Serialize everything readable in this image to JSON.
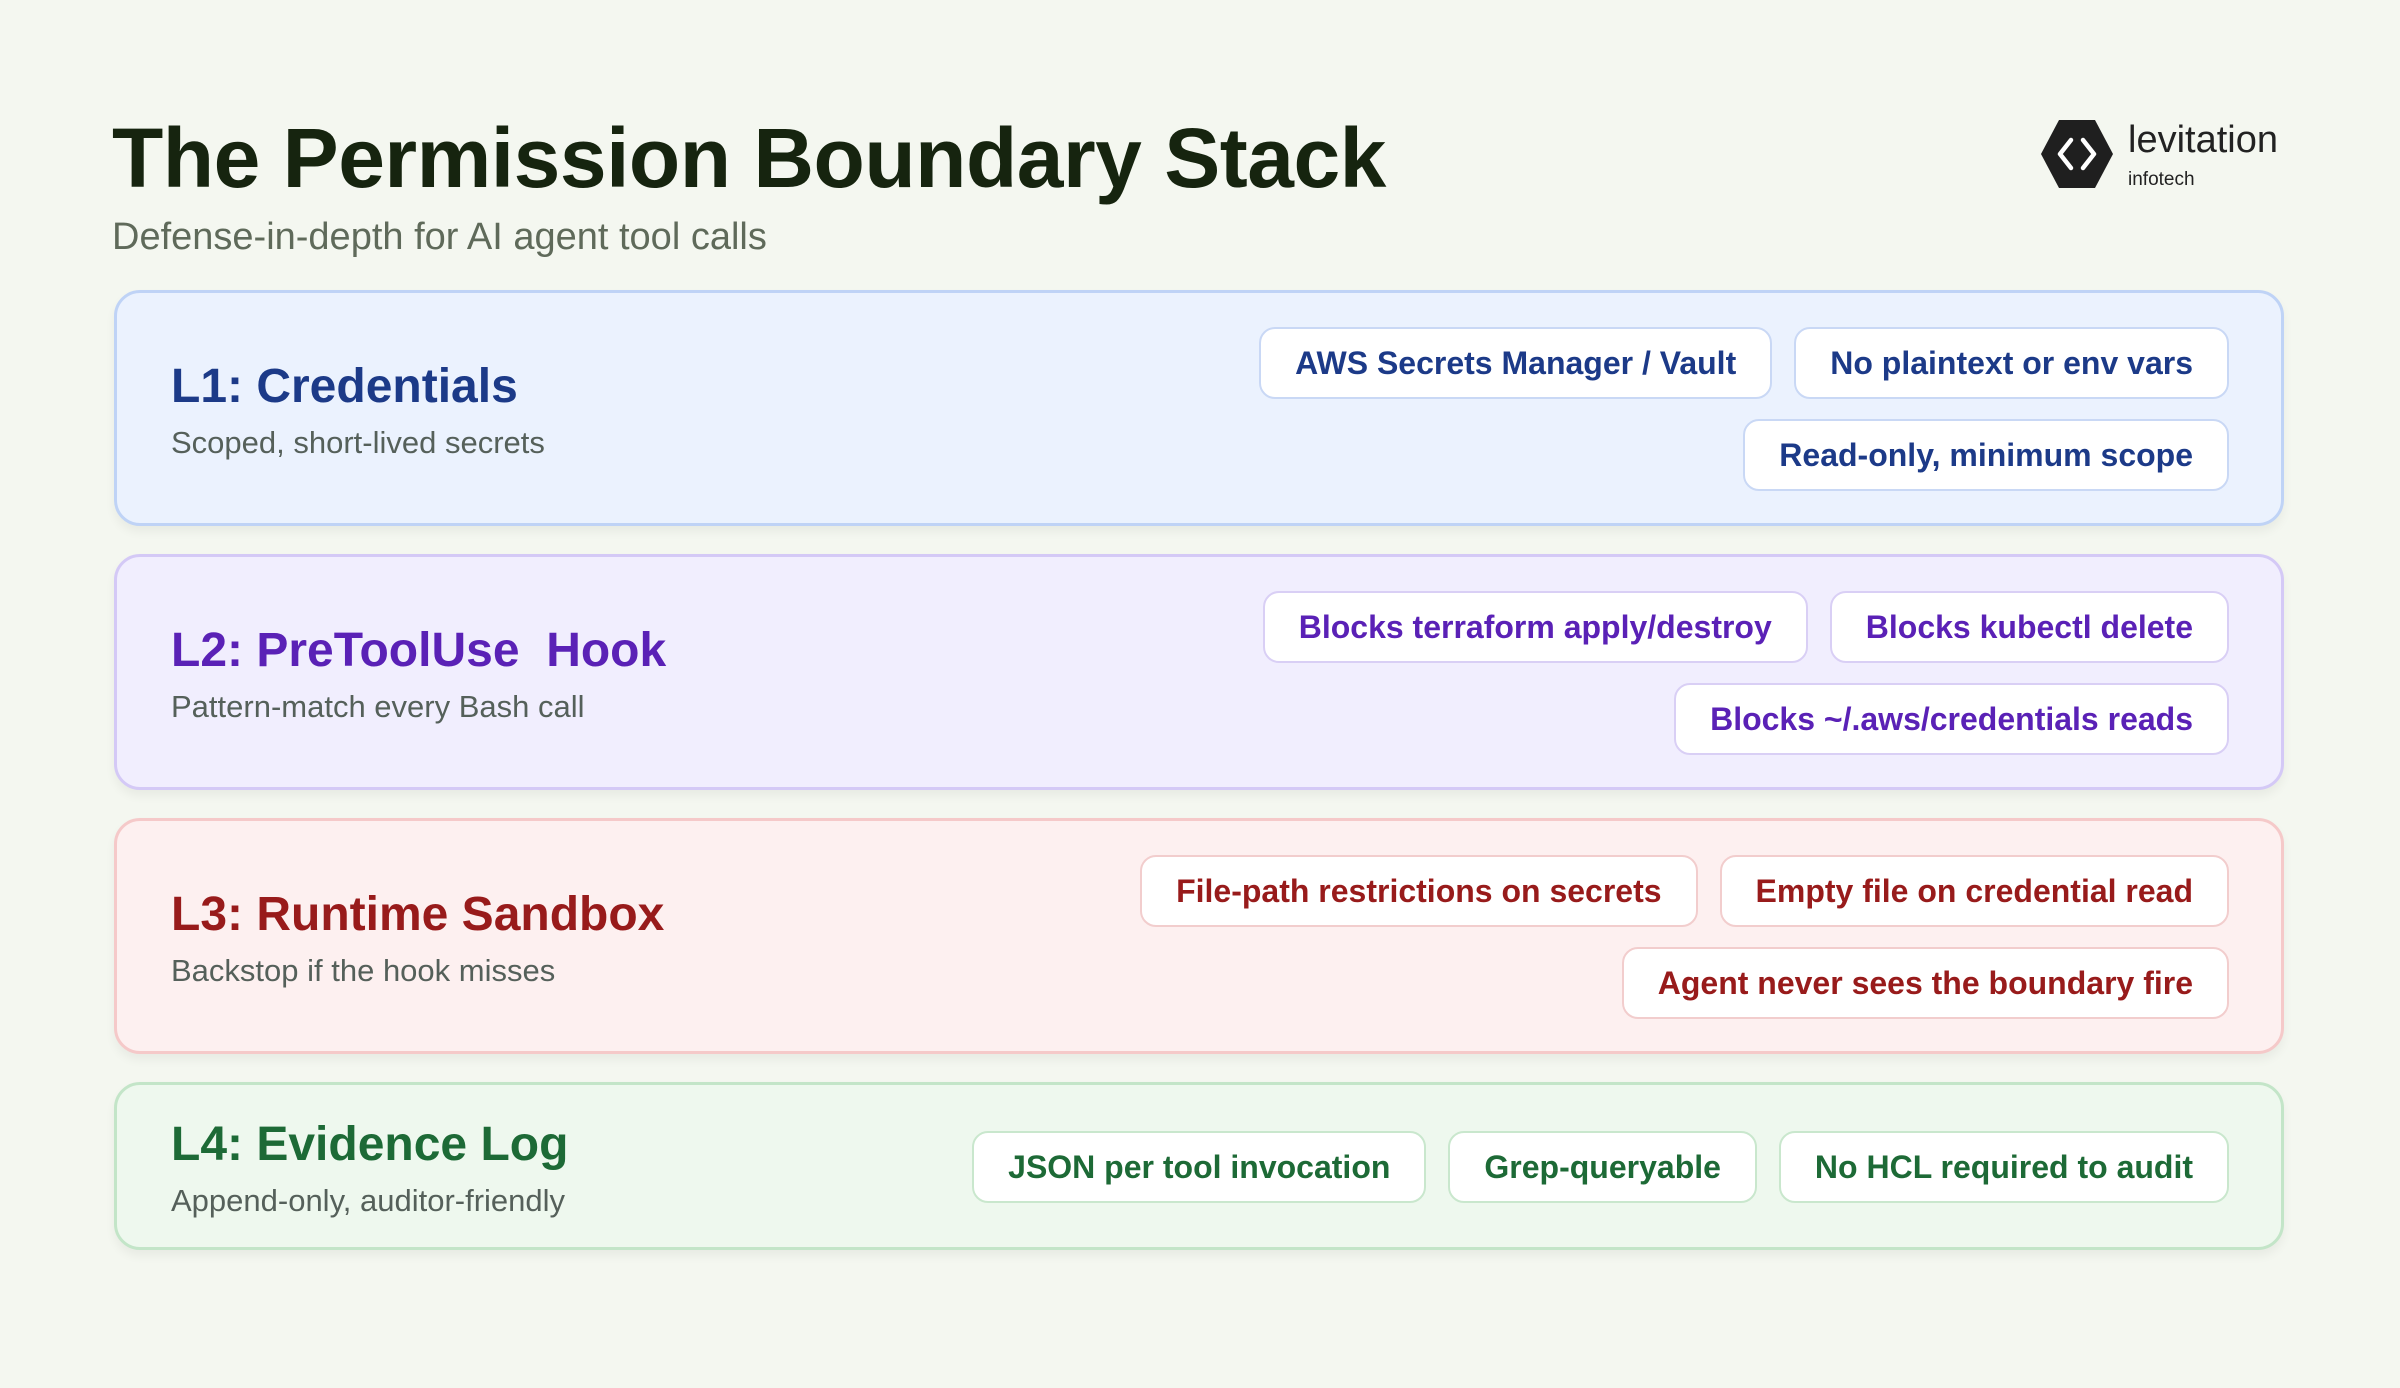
{
  "title": "The Permission Boundary Stack",
  "subtitle": "Defense-in-depth for AI agent tool calls",
  "logo": {
    "name": "levitation",
    "sub": "infotech",
    "icon": "hexagon-code-icon",
    "color": "#1f1f1f"
  },
  "layers": [
    {
      "title": "L1: Credentials",
      "subtitle": "Scoped, short-lived secrets",
      "color": "#1c3a88",
      "chip_rows": [
        [
          "AWS Secrets Manager / Vault",
          "No plaintext or env vars"
        ],
        [
          "Read-only, minimum scope"
        ]
      ]
    },
    {
      "title": "L2: PreToolUse  Hook",
      "subtitle": "Pattern-match every Bash call",
      "color": "#5a21b6",
      "chip_rows": [
        [
          "Blocks terraform apply/destroy",
          "Blocks kubectl delete"
        ],
        [
          "Blocks ~/.aws/credentials reads"
        ]
      ]
    },
    {
      "title": "L3: Runtime Sandbox",
      "subtitle": "Backstop if the hook misses",
      "color": "#981b1b",
      "chip_rows": [
        [
          "File-path restrictions on secrets",
          "Empty file on credential read"
        ],
        [
          "Agent never sees the boundary fire"
        ]
      ]
    },
    {
      "title": "L4: Evidence Log",
      "subtitle": "Append-only, auditor-friendly",
      "color": "#1d6a36",
      "chip_rows": [
        [
          "JSON per tool invocation",
          "Grep-queryable",
          "No HCL required to audit"
        ]
      ]
    }
  ]
}
